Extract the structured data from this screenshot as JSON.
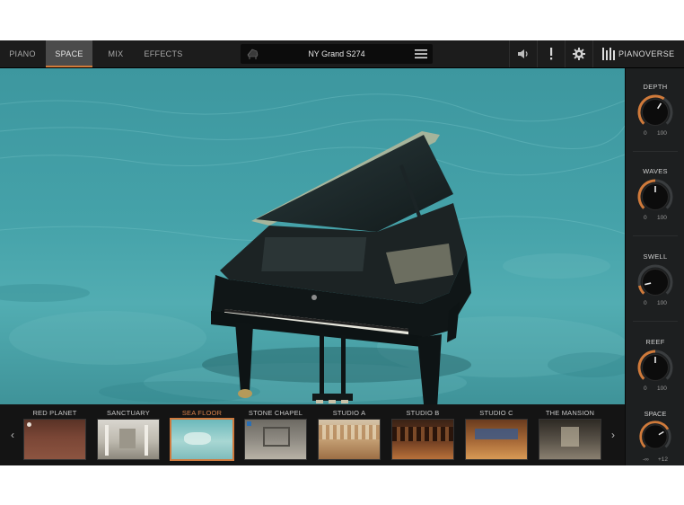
{
  "header": {
    "tabs": [
      {
        "label": "PIANO",
        "active": false
      },
      {
        "label": "SPACE",
        "active": true
      },
      {
        "label": "MIX",
        "active": false
      },
      {
        "label": "EFFECTS",
        "active": false
      }
    ],
    "preset_name": "NY Grand S274",
    "brand": "PIANOVERSE",
    "icons": [
      "speaker-icon",
      "alert-icon",
      "gear-icon",
      "menu-icon"
    ]
  },
  "accent_color": "#d07a3a",
  "knobs": [
    {
      "label": "DEPTH",
      "min": "0",
      "max": "100",
      "level": 0.62
    },
    {
      "label": "WAVES",
      "min": "0",
      "max": "100",
      "level": 0.5
    },
    {
      "label": "SWELL",
      "min": "0",
      "max": "100",
      "level": 0.12
    },
    {
      "label": "REEF",
      "min": "0",
      "max": "100",
      "level": 0.5
    }
  ],
  "space_knob": {
    "label": "SPACE",
    "min": "-∞",
    "max": "+12",
    "level": 0.72
  },
  "rooms": [
    {
      "label": "RED PLANET",
      "active": false
    },
    {
      "label": "SANCTUARY",
      "active": false
    },
    {
      "label": "SEA FLOOR",
      "active": true
    },
    {
      "label": "STONE CHAPEL",
      "active": false
    },
    {
      "label": "STUDIO A",
      "active": false
    },
    {
      "label": "STUDIO B",
      "active": false
    },
    {
      "label": "STUDIO C",
      "active": false
    },
    {
      "label": "THE MANSION",
      "active": false
    }
  ],
  "nav": {
    "prev": "‹",
    "next": "›"
  }
}
